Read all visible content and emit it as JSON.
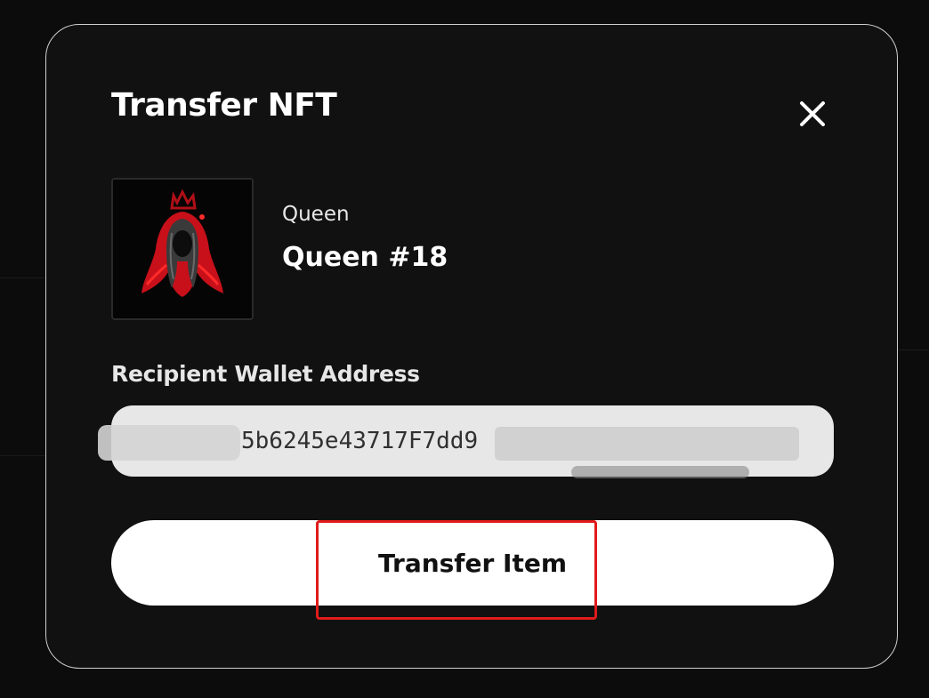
{
  "modal": {
    "title": "Transfer NFT",
    "close_icon": "close-icon"
  },
  "nft": {
    "collection": "Queen",
    "name": "Queen #18",
    "thumbnail_icon": "nft-queen-artwork"
  },
  "recipient": {
    "label": "Recipient Wallet Address",
    "value": "5b6245e43717F7dd9"
  },
  "actions": {
    "transfer_label": "Transfer Item"
  },
  "colors": {
    "modal_bg": "#111111",
    "button_bg": "#ffffff",
    "highlight": "#e11b1b",
    "nft_accent": "#c8101a"
  }
}
